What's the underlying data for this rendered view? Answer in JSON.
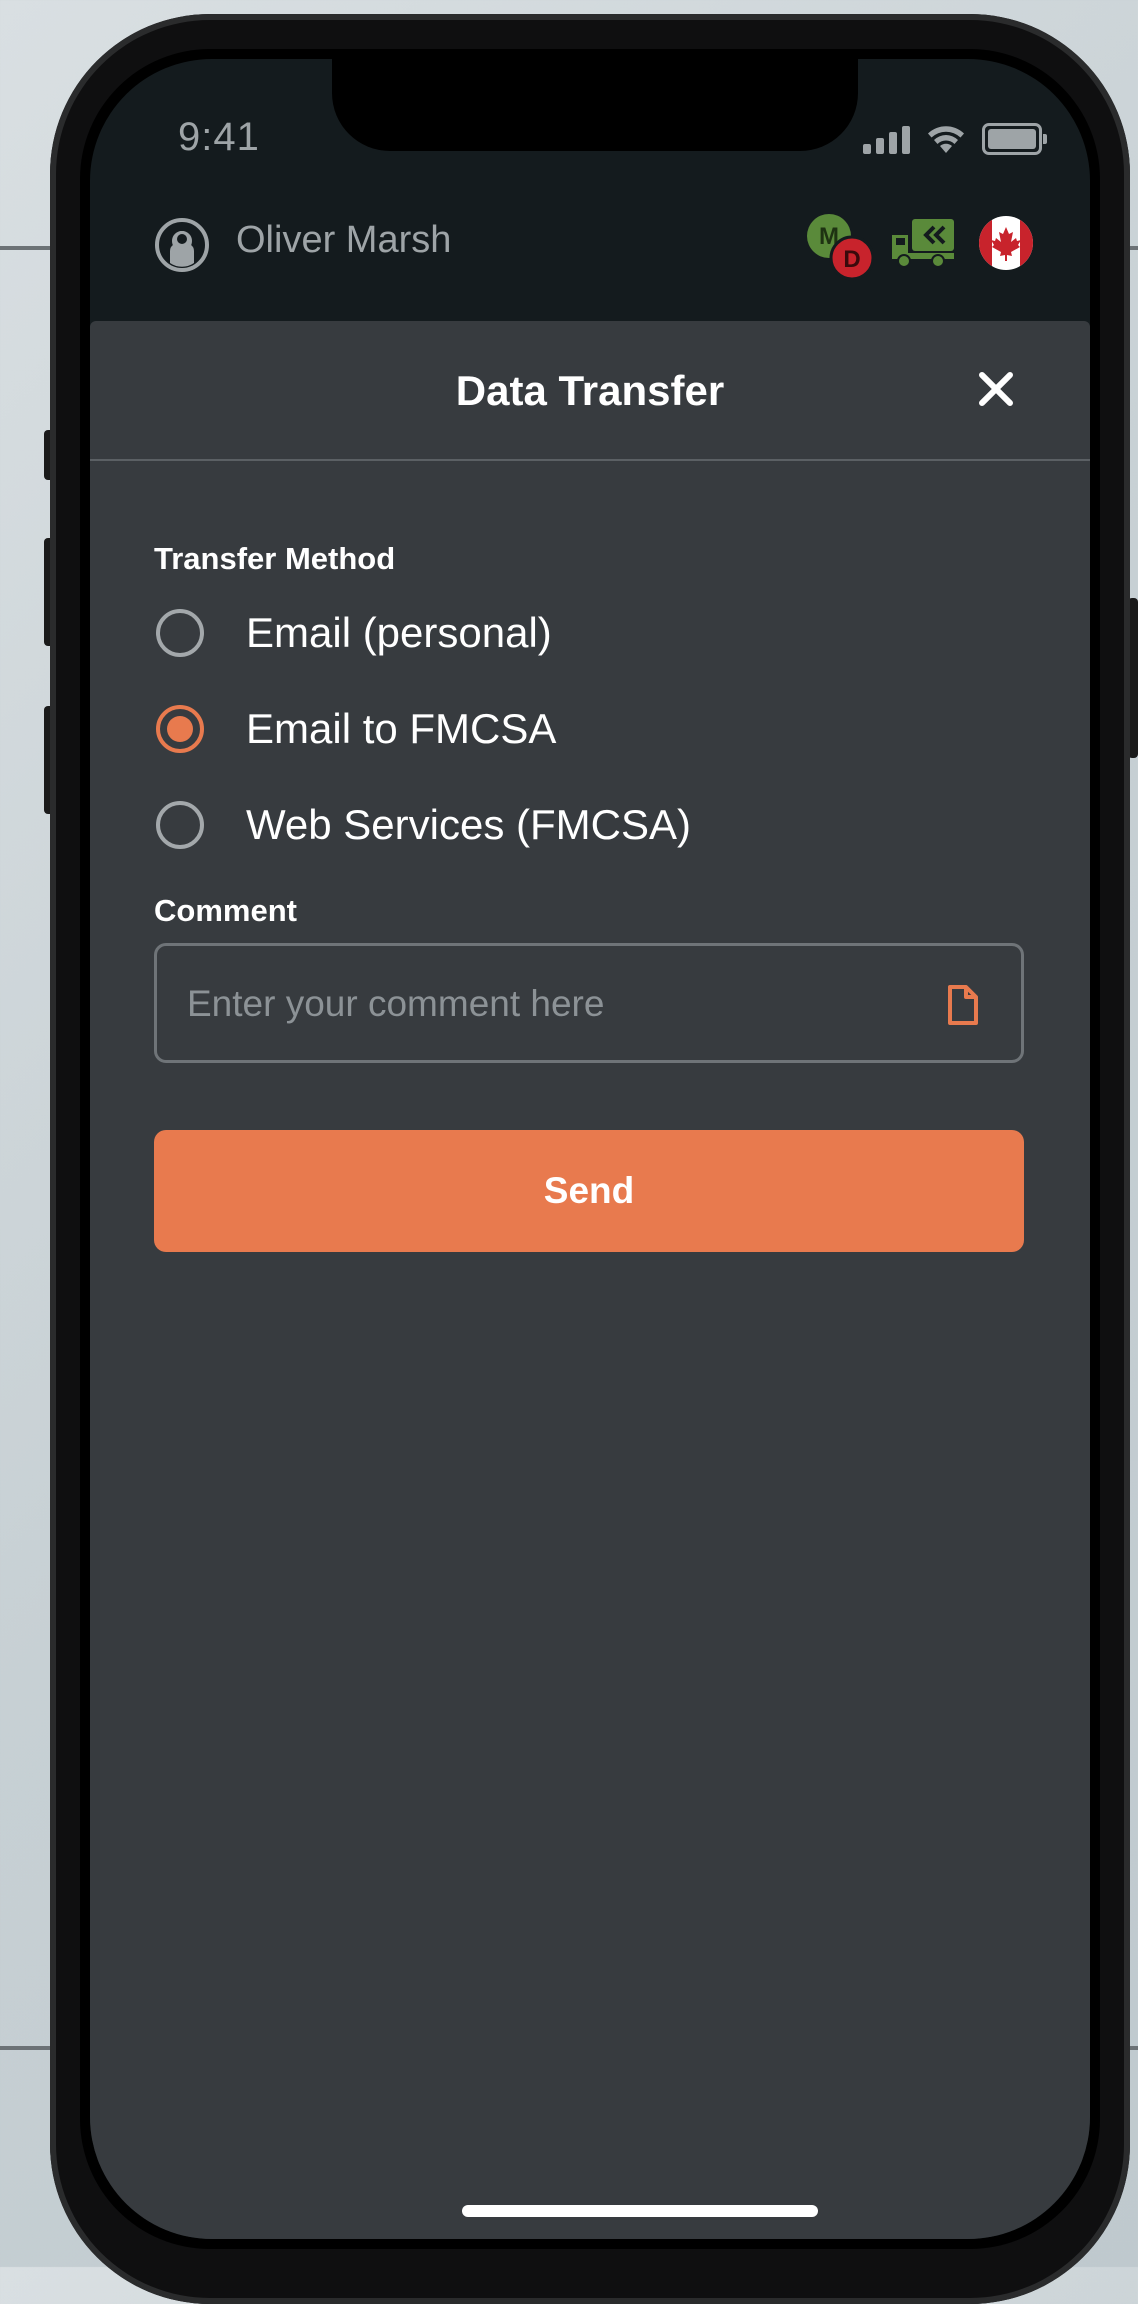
{
  "status_bar": {
    "time": "9:41"
  },
  "header": {
    "user_name": "Oliver Marsh",
    "badge_letters": {
      "top": "M",
      "bottom": "D"
    }
  },
  "sheet": {
    "title": "Data Transfer",
    "transfer_method": {
      "label": "Transfer Method",
      "options": [
        {
          "label": "Email (personal)",
          "selected": false
        },
        {
          "label": "Email to FMCSA",
          "selected": true
        },
        {
          "label": "Web Services (FMCSA)",
          "selected": false
        }
      ]
    },
    "comment": {
      "label": "Comment",
      "placeholder": "Enter your comment here",
      "value": ""
    },
    "send_label": "Send"
  },
  "colors": {
    "accent": "#e87a4e",
    "sheet_bg": "#373b3f",
    "top_bg": "#141b1e",
    "green_icon": "#5a8a3a",
    "red_icon": "#c8232c"
  },
  "icons": {
    "user": "user-circle-icon",
    "status": "md-status-badge-icon",
    "vehicle": "truck-icon",
    "region": "canada-flag-icon",
    "close": "close-icon",
    "attach": "document-icon"
  }
}
